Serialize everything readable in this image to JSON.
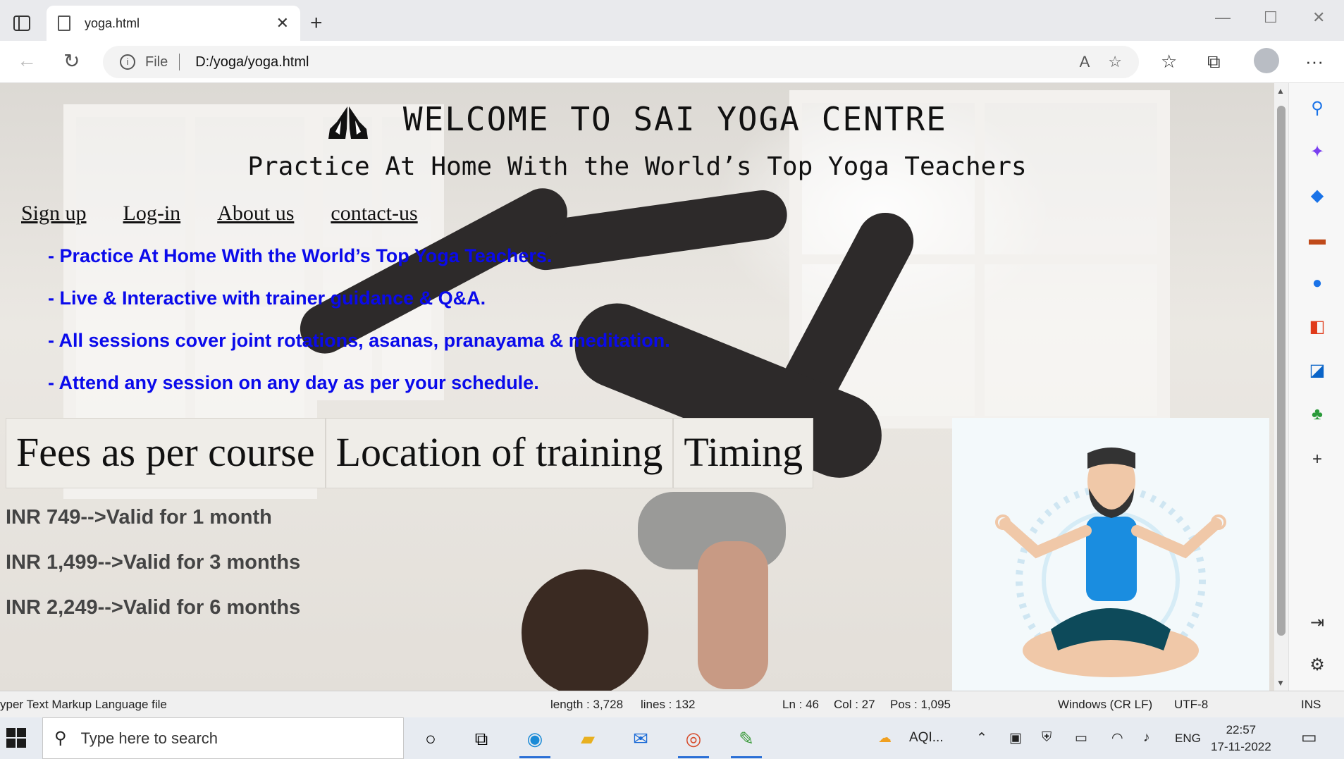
{
  "browser": {
    "tab_title": "yoga.html",
    "address_scheme": "File",
    "address_url": "D:/yoga/yoga.html"
  },
  "page": {
    "title": "WELCOME TO SAI YOGA CENTRE",
    "subtitle": "Practice At Home With the World’s Top Yoga Teachers",
    "nav": [
      "Sign up",
      "Log-in",
      "About us",
      "contact-us"
    ],
    "features": [
      "- Practice At Home With the World’s Top Yoga Teachers.",
      "- Live & Interactive with trainer guidance & Q&A.",
      "- All sessions cover joint rotations, asanas, pranayama & meditation.",
      "- Attend any session on any day as per your schedule."
    ],
    "table_headers": [
      "Fees as per course",
      "Location of training",
      "Timing"
    ],
    "fees": [
      "INR 749-->Valid for 1 month",
      "INR 1,499-->Valid for 3 months",
      "INR 2,249-->Valid for 6 months"
    ]
  },
  "statusbar": {
    "file_type": "yper Text Markup Language file",
    "length": "length : 3,728",
    "lines": "lines : 132",
    "ln": "Ln : 46",
    "col": "Col : 27",
    "pos": "Pos : 1,095",
    "eol": "Windows (CR LF)",
    "encoding": "UTF-8",
    "mode": "INS"
  },
  "taskbar": {
    "search_placeholder": "Type here to search",
    "weather": "AQI...",
    "language": "ENG",
    "time": "22:57",
    "date": "17-11-2022"
  },
  "colors": {
    "feature_text": "#0a0aeb",
    "fee_text": "#444444",
    "table_bg": "#efede8"
  }
}
